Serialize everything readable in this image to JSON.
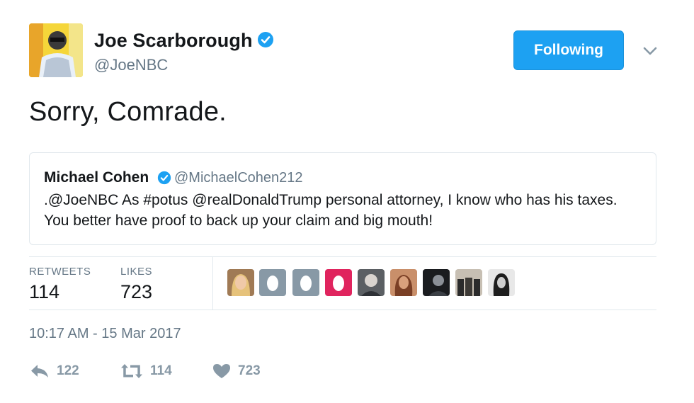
{
  "tweet": {
    "author": {
      "name": "Joe Scarborough",
      "handle": "@JoeNBC",
      "verified": true,
      "avatar_icon": "profile-photo"
    },
    "follow_button_label": "Following",
    "caret_icon": "chevron-down-icon",
    "text": "Sorry, Comrade.",
    "quoted": {
      "name": "Michael Cohen",
      "handle": "@MichaelCohen212",
      "verified": true,
      "text": ".@JoeNBC As #potus @realDonaldTrump personal attorney, I know who has his taxes. You better have proof to back up your claim and big mouth!"
    },
    "stats": {
      "retweets_label": "RETWEETS",
      "retweets_value": "114",
      "likes_label": "LIKES",
      "likes_value": "723"
    },
    "likers": [
      {
        "icon": "liker-avatar-photo"
      },
      {
        "icon": "default-egg-avatar"
      },
      {
        "icon": "default-egg-avatar"
      },
      {
        "icon": "default-egg-avatar"
      },
      {
        "icon": "liker-avatar-photo"
      },
      {
        "icon": "liker-avatar-photo"
      },
      {
        "icon": "liker-avatar-photo"
      },
      {
        "icon": "liker-avatar-photo"
      },
      {
        "icon": "liker-avatar-photo"
      }
    ],
    "timestamp": "10:17 AM - 15 Mar 2017",
    "actions": {
      "reply_icon": "reply-icon",
      "reply_count": "122",
      "retweet_icon": "retweet-icon",
      "retweet_count": "114",
      "like_icon": "heart-icon",
      "like_count": "723"
    },
    "colors": {
      "accent": "#1da1f2",
      "text": "#14171a",
      "secondary": "#657786",
      "action": "#8899a6",
      "border": "#e1e8ed"
    }
  }
}
